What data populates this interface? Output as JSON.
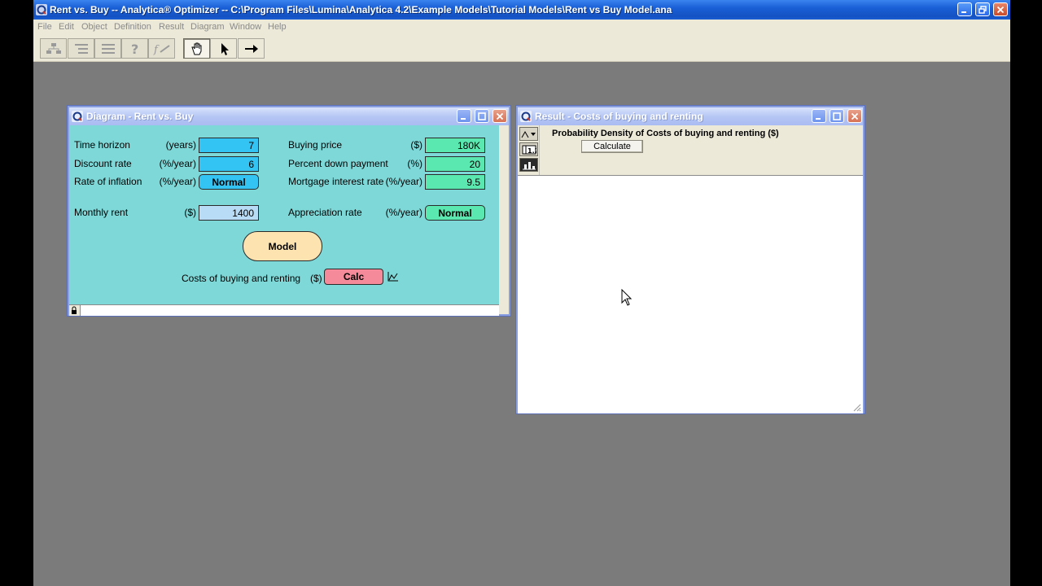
{
  "app": {
    "title": "Rent vs. Buy -- Analytica® Optimizer -- C:\\Program Files\\Lumina\\Analytica 4.2\\Example Models\\Tutorial Models\\Rent vs Buy Model.ana",
    "menu": [
      "File",
      "Edit",
      "Object",
      "Definition",
      "Result",
      "Diagram",
      "Window",
      "Help"
    ],
    "toolbar": [
      {
        "icon": "hierarchy-icon",
        "state": "disabled"
      },
      {
        "icon": "outline-icon",
        "state": "disabled"
      },
      {
        "icon": "list-icon",
        "state": "disabled"
      },
      {
        "icon": "help-object-icon",
        "state": "disabled"
      },
      {
        "icon": "formula-icon",
        "state": "disabled"
      },
      {
        "icon": "hand-browse-icon",
        "state": "pressed"
      },
      {
        "icon": "arrow-edit-icon",
        "state": "normal"
      },
      {
        "icon": "arrow-connect-icon",
        "state": "normal"
      }
    ]
  },
  "diagram": {
    "title": "Diagram - Rent vs. Buy",
    "left_inputs": [
      {
        "label": "Time horizon",
        "unit": "(years)",
        "value": "7",
        "style": "cyan"
      },
      {
        "label": "Discount rate",
        "unit": "(%/year)",
        "value": "6",
        "style": "cyan"
      },
      {
        "label": "Rate of inflation",
        "unit": "(%/year)",
        "value": "Normal",
        "style": "cyan-pill"
      },
      {
        "label": "Monthly rent",
        "unit": "($)",
        "value": "1400",
        "style": "light"
      }
    ],
    "right_inputs": [
      {
        "label": "Buying price",
        "unit": "($)",
        "value": "180K",
        "style": "green"
      },
      {
        "label": "Percent down payment",
        "unit": "(%)",
        "value": "20",
        "style": "green"
      },
      {
        "label": "Mortgage interest rate",
        "unit": "(%/year)",
        "value": "9.5",
        "style": "green"
      },
      {
        "label": "Appreciation rate",
        "unit": "(%/year)",
        "value": "Normal",
        "style": "green-pill"
      }
    ],
    "model_node": "Model",
    "output": {
      "label": "Costs of buying and renting",
      "unit": "($)",
      "button": "Calc"
    }
  },
  "result": {
    "title": "Result - Costs of buying and renting",
    "heading": "Probability Density of Costs of buying and renting ($)",
    "calculate_label": "Calculate"
  },
  "colors": {
    "diagram_bg": "#7fd8d8",
    "input_cyan": "#34c4f4",
    "input_green": "#5ae8b0",
    "input_light": "#b8dcf6",
    "model_node": "#fde3b0",
    "calc_node": "#f48a9a",
    "desktop": "#7b7b7b"
  }
}
